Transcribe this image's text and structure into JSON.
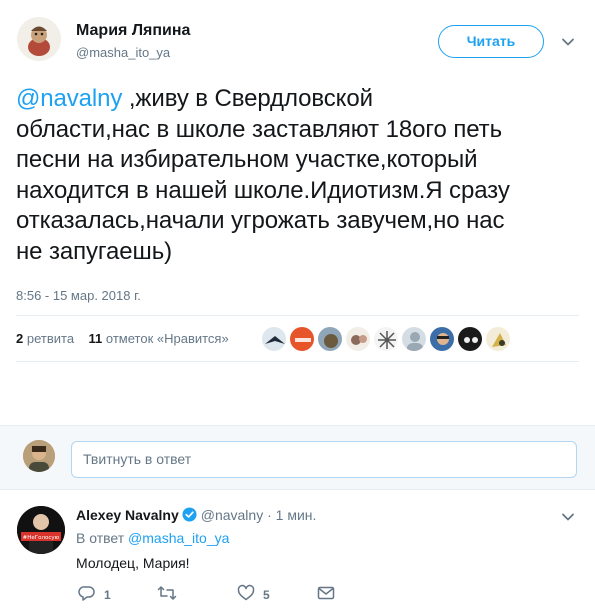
{
  "tweet": {
    "author_name": "Мария Ляпина",
    "author_handle": "@masha_ito_ya",
    "follow_label": "Читать",
    "mention": "@navalny",
    "text_lines": [
      " ,живу в Свердловской",
      "области,нас в школе заставляют 18ого петь",
      "песни на избирательном участке,который",
      "находится в нашей школе.Идиотизм.Я сразу",
      "отказалась,начали угрожать завучем,но нас",
      "не запугаешь)"
    ],
    "timestamp": "8:56 - 15 мар. 2018 г.",
    "retweets_count": "2",
    "retweets_label": "ретвита",
    "likes_count": "11",
    "likes_label": "отметок «Нравится»"
  },
  "likers": {
    "count": 9
  },
  "reply_box": {
    "placeholder": "Твитнуть в ответ"
  },
  "reply": {
    "name": "Alexey Navalny",
    "handle": "@navalny",
    "time": "· 1 мин.",
    "in_reply_prefix": "В ответ",
    "in_reply_handle": "@masha_ito_ya",
    "body": "Молодец, Мария!",
    "avatar_text": "#НеГолосую",
    "reply_count": "1",
    "retweet_count": "",
    "like_count": "5"
  },
  "colors": {
    "accent": "#1da1f2",
    "muted": "#657786",
    "text": "#14171a"
  }
}
